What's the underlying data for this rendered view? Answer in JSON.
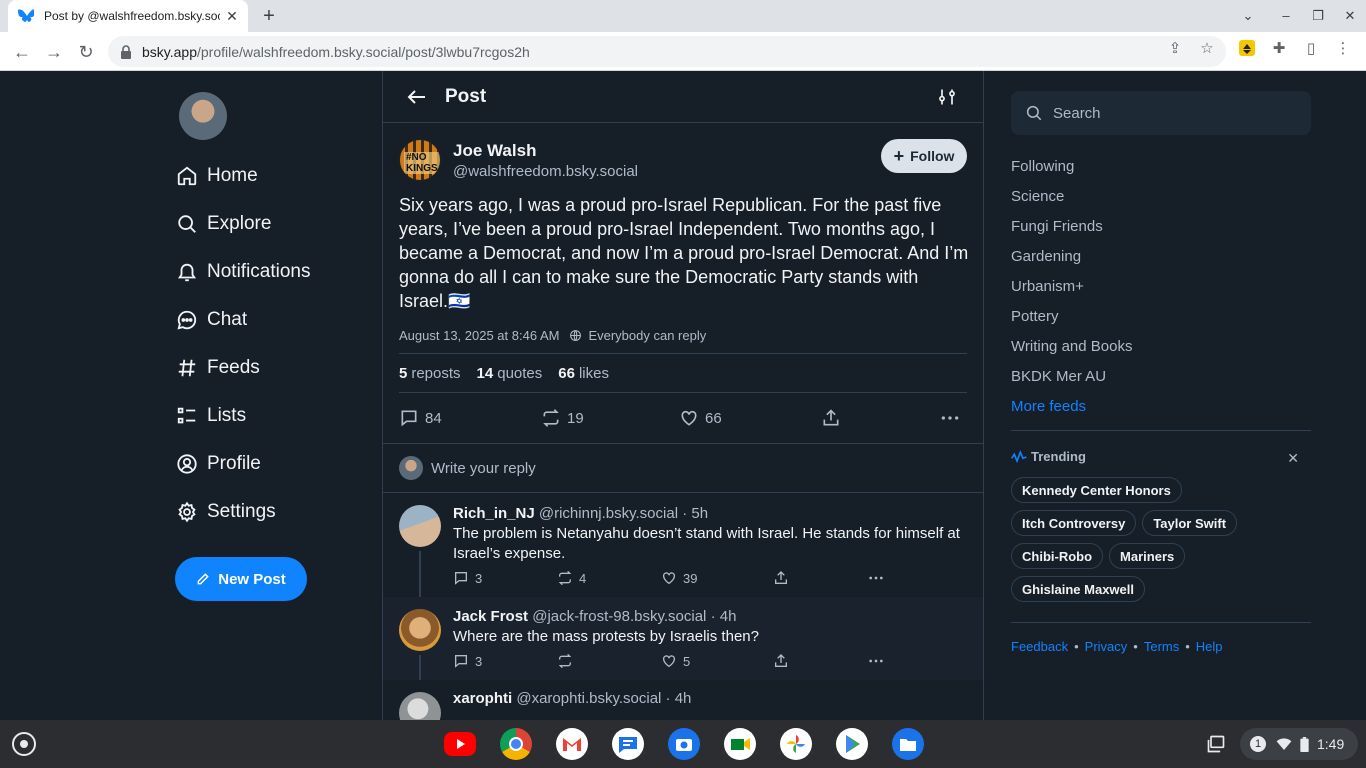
{
  "browser": {
    "tab_title": "Post by @walshfreedom.bsky.social",
    "url_host": "bsky.app",
    "url_path": "/profile/walshfreedom.bsky.social/post/3lwbu7rcgos2h"
  },
  "nav": {
    "items": [
      {
        "label": "Home",
        "icon": "home-icon"
      },
      {
        "label": "Explore",
        "icon": "search-icon"
      },
      {
        "label": "Notifications",
        "icon": "bell-icon"
      },
      {
        "label": "Chat",
        "icon": "chat-icon"
      },
      {
        "label": "Feeds",
        "icon": "hash-icon"
      },
      {
        "label": "Lists",
        "icon": "list-icon"
      },
      {
        "label": "Profile",
        "icon": "user-circle-icon"
      },
      {
        "label": "Settings",
        "icon": "gear-icon"
      }
    ],
    "new_post_label": "New Post"
  },
  "header": {
    "title": "Post"
  },
  "post": {
    "author_name": "Joe Walsh",
    "author_handle": "@walshfreedom.bsky.social",
    "avatar_text": "#NO KINGS",
    "follow_label": "Follow",
    "text": "Six years ago, I was a proud pro-Israel Republican. For the past five years, I’ve been a proud pro-Israel Independent. Two months ago, I became a Democrat, and now I’m a proud pro-Israel Democrat. And I’m gonna do all I can to make sure the Democratic Party stands with Israel.🇮🇱",
    "timestamp": "August 13, 2025 at 8:46 AM",
    "reply_setting": "Everybody can reply",
    "reposts_count": "5",
    "reposts_label": "reposts",
    "quotes_count": "14",
    "quotes_label": "quotes",
    "likes_count": "66",
    "likes_label": "likes",
    "replies_action": "84",
    "reposts_action": "19",
    "likes_action": "66"
  },
  "reply_box": {
    "placeholder": "Write your reply"
  },
  "replies": [
    {
      "name": "Rich_in_NJ",
      "handle": "@richinnj.bsky.social",
      "time": "· 5h",
      "text": "The problem is Netanyahu doesn’t stand with Israel. He stands for himself at Israel’s expense.",
      "replies": "3",
      "reposts": "4",
      "likes": "39"
    },
    {
      "name": "Jack Frost",
      "handle": "@jack-frost-98.bsky.social",
      "time": "· 4h",
      "text": "Where are the mass protests by Israelis then?",
      "replies": "3",
      "reposts": "",
      "likes": "5"
    },
    {
      "name": "xarophti",
      "handle": "@xarophti.bsky.social",
      "time": "· 4h",
      "text": ""
    }
  ],
  "sidebar": {
    "search_placeholder": "Search",
    "feeds": [
      "Following",
      "Science",
      "Fungi Friends",
      "Gardening",
      "Urbanism+",
      "Pottery",
      "Writing and Books",
      "BKDK Mer AU"
    ],
    "more_feeds": "More feeds",
    "trending_title": "Trending",
    "trending": [
      "Kennedy Center Honors",
      "Itch Controversy",
      "Taylor Swift",
      "Chibi-Robo",
      "Mariners",
      "Ghislaine Maxwell"
    ],
    "footer": [
      "Feedback",
      "Privacy",
      "Terms",
      "Help"
    ]
  },
  "shelf": {
    "apps": [
      "youtube-icon",
      "chrome-icon",
      "gmail-icon",
      "messages-icon",
      "camera-icon",
      "meet-icon",
      "photos-icon",
      "play-store-icon",
      "files-icon"
    ],
    "notification_count": "1",
    "time": "1:49"
  },
  "colors": {
    "accent": "#1083fe",
    "background": "#161e27",
    "border": "#2e4052",
    "muted": "#aebbc9"
  }
}
